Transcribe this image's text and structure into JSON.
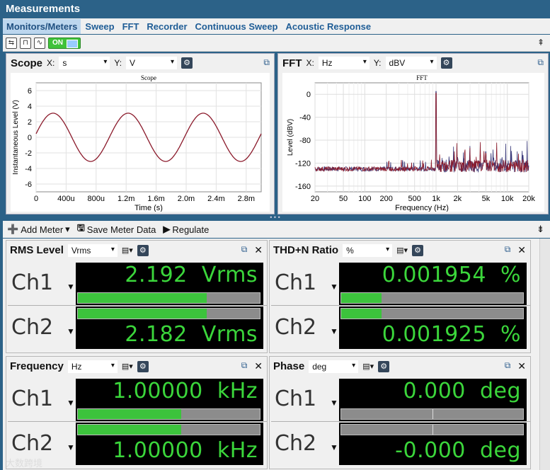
{
  "window": {
    "title": "Measurements"
  },
  "tabs": [
    "Monitors/Meters",
    "Sweep",
    "FFT",
    "Recorder",
    "Continuous Sweep",
    "Acoustic Response"
  ],
  "toolbar": {
    "on_label": "ON"
  },
  "scope": {
    "title": "Scope",
    "x_label": "X:",
    "x_unit": "s",
    "y_label": "Y:",
    "y_unit": "V"
  },
  "fft": {
    "title": "FFT",
    "x_label": "X:",
    "x_unit": "Hz",
    "y_label": "Y:",
    "y_unit": "dBV"
  },
  "meter_toolbar": {
    "add": "Add Meter",
    "save": "Save Meter Data",
    "regulate": "Regulate"
  },
  "meters": [
    {
      "title": "RMS Level",
      "unit": "Vrms",
      "channels": [
        {
          "label": "Ch1",
          "value": "2.192  Vrms",
          "level": 0.71
        },
        {
          "label": "Ch2",
          "value": "2.182  Vrms",
          "level": 0.71
        }
      ]
    },
    {
      "title": "THD+N Ratio",
      "unit": "%",
      "channels": [
        {
          "label": "Ch1",
          "value": "0.001954  %",
          "level": 0.22
        },
        {
          "label": "Ch2",
          "value": "0.001925  %",
          "level": 0.22
        }
      ]
    },
    {
      "title": "Frequency",
      "unit": "Hz",
      "channels": [
        {
          "label": "Ch1",
          "value": "1.00000  kHz",
          "level": 0.57
        },
        {
          "label": "Ch2",
          "value": "1.00000  kHz",
          "level": 0.57
        }
      ]
    },
    {
      "title": "Phase",
      "unit": "deg",
      "channels": [
        {
          "label": "Ch1",
          "value": "0.000  deg",
          "level": 0.5
        },
        {
          "label": "Ch2",
          "value": "-0.000  deg",
          "level": 0.5
        }
      ]
    }
  ],
  "watermark": "大数跨境",
  "chart_data": [
    {
      "type": "line",
      "title": "Scope",
      "xlabel": "Time (s)",
      "ylabel": "Instantaneous Level (V)",
      "xticks": [
        "0",
        "400u",
        "800u",
        "1.2m",
        "1.6m",
        "2.0m",
        "2.4m",
        "2.8m"
      ],
      "yticks": [
        "6",
        "4",
        "2",
        "0",
        "-2",
        "-4",
        "-6"
      ],
      "xlim": [
        0,
        0.003
      ],
      "ylim": [
        -7,
        7
      ],
      "series": [
        {
          "values_desc": "sine",
          "amplitude": 3.1,
          "frequency": 1000,
          "color": "#8b1a2b"
        }
      ]
    },
    {
      "type": "line",
      "title": "FFT",
      "xlabel": "Frequency (Hz)",
      "ylabel": "Level (dBV)",
      "xticks": [
        "20",
        "50",
        "100",
        "200",
        "500",
        "1k",
        "2k",
        "5k",
        "10k",
        "20k"
      ],
      "yticks": [
        "0",
        "-40",
        "-80",
        "-120",
        "-160"
      ],
      "xlim": [
        20,
        20000
      ],
      "ylim": [
        -170,
        20
      ],
      "peaks": [
        {
          "x": 1000,
          "y": 5
        },
        {
          "x": 3000,
          "y": -90
        },
        {
          "x": 2000,
          "y": -110
        },
        {
          "x": 5000,
          "y": -100
        }
      ],
      "noise_floor": -130
    }
  ]
}
